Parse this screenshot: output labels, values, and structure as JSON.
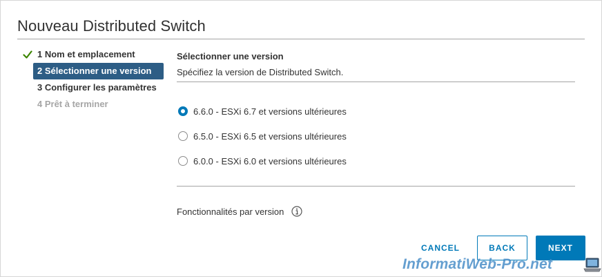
{
  "dialog": {
    "title": "Nouveau Distributed Switch"
  },
  "steps": [
    {
      "label": "1 Nom et emplacement",
      "state": "completed",
      "icon": "checkmark-icon"
    },
    {
      "label": "2 Sélectionner une version",
      "state": "active"
    },
    {
      "label": "3 Configurer les paramètres",
      "state": "pending"
    },
    {
      "label": "4 Prêt à terminer",
      "state": "disabled"
    }
  ],
  "content": {
    "title": "Sélectionner une version",
    "description": "Spécifiez la version de Distributed Switch.",
    "options": [
      {
        "label": "6.6.0 - ESXi 6.7 et versions ultérieures",
        "selected": true
      },
      {
        "label": "6.5.0 - ESXi 6.5 et versions ultérieures",
        "selected": false
      },
      {
        "label": "6.0.0 - ESXi 6.0 et versions ultérieures",
        "selected": false
      }
    ],
    "features_label": "Fonctionnalités par version",
    "features_icon": "info-icon"
  },
  "footer": {
    "cancel_label": "CANCEL",
    "back_label": "BACK",
    "next_label": "NEXT"
  },
  "watermark": {
    "text": "InformatiWeb-Pro.net"
  },
  "colors": {
    "accent": "#0079b8",
    "active_step_bg": "#2d5d85",
    "check_green": "#3c8500",
    "disabled_text": "#a6a6a6"
  }
}
